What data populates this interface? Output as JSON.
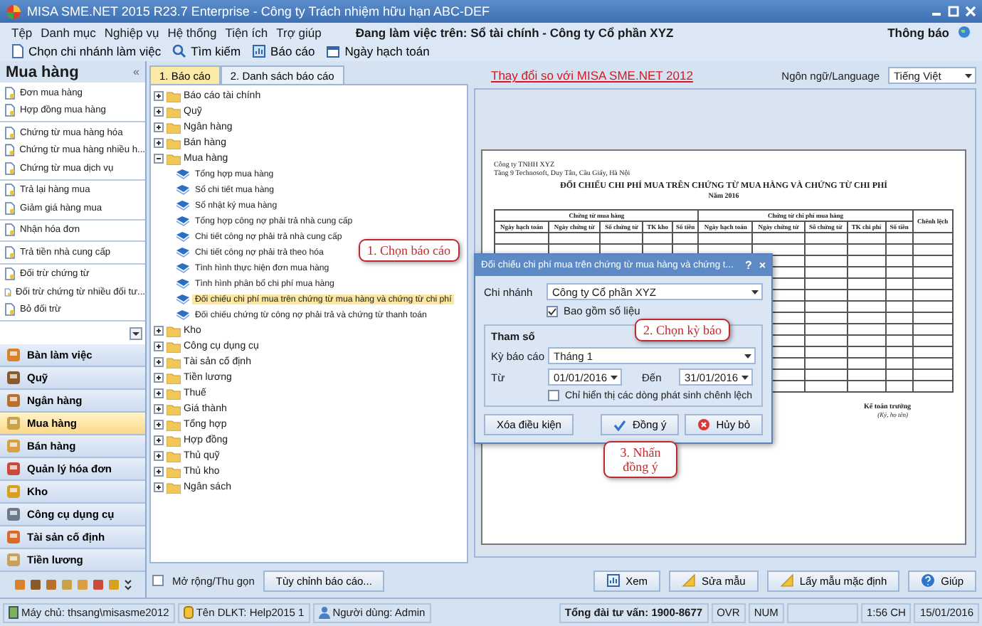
{
  "window": {
    "title": "MISA SME.NET 2015 R23.7 Enterprise - Công ty Trách nhiệm hữu hạn ABC-DEF"
  },
  "menu": [
    "Tệp",
    "Danh mục",
    "Nghiệp vụ",
    "Hệ thống",
    "Tiện ích",
    "Trợ giúp"
  ],
  "working_on": "Đang làm việc trên: Sổ tài chính - Công ty Cổ phần XYZ",
  "notifications": "Thông báo",
  "toolbar": [
    {
      "label": "Chọn chi nhánh làm việc",
      "kind": "page"
    },
    {
      "label": "Tìm kiếm",
      "kind": "search"
    },
    {
      "label": "Báo cáo",
      "kind": "report"
    },
    {
      "label": "Ngày hạch toán",
      "kind": "calendar"
    }
  ],
  "sidebar": {
    "title": "Mua hàng",
    "collapse": "«",
    "groups": [
      [
        "Đơn mua hàng",
        "Hợp đồng mua hàng"
      ],
      [
        "Chứng từ mua hàng hóa",
        "Chứng từ mua hàng nhiều h...",
        "Chứng từ mua dịch vụ"
      ],
      [
        "Trả lại hàng mua",
        "Giảm giá hàng mua"
      ],
      [
        "Nhận hóa đơn"
      ],
      [
        "Trả tiền nhà cung cấp"
      ],
      [
        "Đối trừ chứng từ",
        "Đối trừ chứng từ nhiều đối tư...",
        "Bỏ đối trừ"
      ]
    ],
    "modules": [
      {
        "label": "Bàn làm việc",
        "selected": false
      },
      {
        "label": "Quỹ",
        "selected": false
      },
      {
        "label": "Ngân hàng",
        "selected": false
      },
      {
        "label": "Mua hàng",
        "selected": true
      },
      {
        "label": "Bán hàng",
        "selected": false
      },
      {
        "label": "Quản lý hóa đơn",
        "selected": false
      },
      {
        "label": "Kho",
        "selected": false
      },
      {
        "label": "Công cụ dụng cụ",
        "selected": false
      },
      {
        "label": "Tài sản cố định",
        "selected": false
      },
      {
        "label": "Tiền lương",
        "selected": false
      }
    ]
  },
  "tabs": [
    {
      "label": "1. Báo cáo",
      "selected": true
    },
    {
      "label": "2. Danh sách báo cáo",
      "selected": false
    }
  ],
  "tree": [
    {
      "label": "Báo cáo tài chính",
      "expanded": false
    },
    {
      "label": "Quỹ",
      "expanded": false
    },
    {
      "label": "Ngân hàng",
      "expanded": false
    },
    {
      "label": "Bán hàng",
      "expanded": false
    },
    {
      "label": "Mua hàng",
      "expanded": true,
      "children": [
        {
          "label": "Tổng hợp mua hàng",
          "selected": false
        },
        {
          "label": "Sổ chi tiết mua hàng",
          "selected": false
        },
        {
          "label": "Sổ nhật ký mua hàng",
          "selected": false
        },
        {
          "label": "Tổng hợp công nợ phải trả nhà cung cấp",
          "selected": false
        },
        {
          "label": "Chi tiết công nợ phải trả nhà cung cấp",
          "selected": false
        },
        {
          "label": "Chi tiết công nợ phải trả theo hóa",
          "selected": false
        },
        {
          "label": "Tình hình thực hiện đơn mua hàng",
          "selected": false
        },
        {
          "label": "Tình hình phân bổ chi phí mua hàng",
          "selected": false
        },
        {
          "label": "Đối chiếu chi phí mua trên chứng từ mua hàng và chứng từ chi phí",
          "selected": true
        },
        {
          "label": "Đối chiếu chứng từ công nợ phải trả và chứng từ thanh toán",
          "selected": false
        }
      ]
    },
    {
      "label": "Kho",
      "expanded": false
    },
    {
      "label": "Công cụ dụng cụ",
      "expanded": false
    },
    {
      "label": "Tài sản cố định",
      "expanded": false
    },
    {
      "label": "Tiền lương",
      "expanded": false
    },
    {
      "label": "Thuế",
      "expanded": false
    },
    {
      "label": "Giá thành",
      "expanded": false
    },
    {
      "label": "Tổng hợp",
      "expanded": false
    },
    {
      "label": "Hợp đồng",
      "expanded": false
    },
    {
      "label": "Thủ quỹ",
      "expanded": false
    },
    {
      "label": "Thủ kho",
      "expanded": false
    },
    {
      "label": "Ngân sách",
      "expanded": false
    }
  ],
  "compare_link": "Thay đổi so với MISA SME.NET 2012",
  "language": {
    "label": "Ngôn ngữ/Language",
    "value": "Tiếng Việt"
  },
  "report": {
    "company": "Công ty TNHH XYZ",
    "address": "Tầng 9 Technosoft, Duy Tân, Cầu Giấy, Hà Nội",
    "title": "ĐỐI CHIẾU CHI PHÍ MUA TRÊN CHỨNG TỪ MUA HÀNG VÀ CHỨNG TỪ CHI PHÍ",
    "year": "Năm 2016",
    "group_headers": [
      "Chứng từ mua hàng",
      "Chứng từ chi phí mua hàng",
      "Chênh lệch"
    ],
    "columns": [
      "Ngày hạch toán",
      "Ngày chứng từ",
      "Số chứng từ",
      "TK kho",
      "Số tiền",
      "Ngày hạch toán",
      "Ngày chứng từ",
      "Số chứng từ",
      "TK chi phí",
      "Số tiền"
    ],
    "signer": "Kế toán trưởng",
    "sign_note": "(Ký, họ tên)"
  },
  "dialog": {
    "title": "Đối chiếu chi phí mua trên chứng từ mua hàng và chứng t...",
    "help": "?",
    "close": "×",
    "branch_label": "Chi nhánh",
    "branch": "Công ty Cổ phần XYZ",
    "include": {
      "label": "Bao gồm số liệu",
      "checked": true
    },
    "params_title": "Tham số",
    "period_label": "Kỳ báo cáo",
    "period": "Tháng 1",
    "from_label": "Từ",
    "from": "01/01/2016",
    "to_label": "Đến",
    "to": "31/01/2016",
    "diff_only": {
      "label": "Chỉ hiển thị các dòng phát sinh chênh lệch",
      "checked": false
    },
    "clear": "Xóa điều kiện",
    "ok": "Đồng ý",
    "cancel": "Hủy bỏ"
  },
  "callouts": [
    "1. Chọn báo cáo",
    "2. Chọn kỳ báo",
    "3. Nhấn đồng ý"
  ],
  "bottom": {
    "expand": {
      "label": "Mở rộng/Thu gọn",
      "checked": false
    },
    "customize": "Tùy chỉnh báo cáo...",
    "actions": [
      {
        "label": "Xem",
        "kind": "view"
      },
      {
        "label": "Sửa mẫu",
        "kind": "edit"
      },
      {
        "label": "Lấy mẫu mặc định",
        "kind": "edit"
      },
      {
        "label": "Giúp",
        "kind": "help"
      }
    ]
  },
  "status_bar": {
    "server": "Máy chủ: thsang\\misasme2012",
    "db": "Tên DLKT: Help2015 1",
    "user": "Người dùng: Admin",
    "hotline": "Tổng đài tư vấn: 1900-8677",
    "ovr": "OVR",
    "num": "NUM",
    "time": "1:56 CH",
    "date": "15/01/2016"
  }
}
